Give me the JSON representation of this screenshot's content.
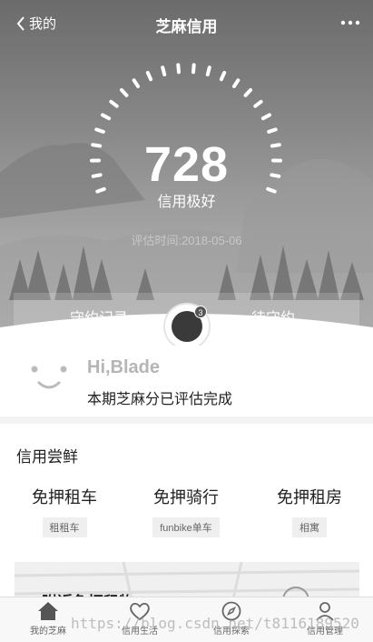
{
  "nav": {
    "back_label": "我的",
    "title": "芝麻信用"
  },
  "credit": {
    "score": "728",
    "level": "信用极好",
    "evaluated": "评估时间:2018-05-06"
  },
  "tabs": {
    "left": "守约记录",
    "right": "待守约",
    "badge_count": "3"
  },
  "greeting": {
    "hello": "Hi,Blade",
    "message": "本期芝麻分已评估完成"
  },
  "section": {
    "title": "信用尝鲜"
  },
  "cards": [
    {
      "title": "免押租车",
      "tag": "租租车"
    },
    {
      "title": "免押骑行",
      "tag": "funbike单车"
    },
    {
      "title": "免押租房",
      "tag": "相寓"
    }
  ],
  "promo": {
    "title": "附近免押租物"
  },
  "tabbar": [
    {
      "label": "我的芝麻",
      "icon": "home-icon"
    },
    {
      "label": "信用生活",
      "icon": "heart-icon"
    },
    {
      "label": "信用探索",
      "icon": "compass-icon"
    },
    {
      "label": "信用管理",
      "icon": "user-icon"
    }
  ],
  "watermark": "https://blog.csdn.net/t8116189520",
  "colors": {
    "hero_gray": "#8a8a8a",
    "text_dark": "#222222",
    "tag_bg": "#efefef"
  }
}
